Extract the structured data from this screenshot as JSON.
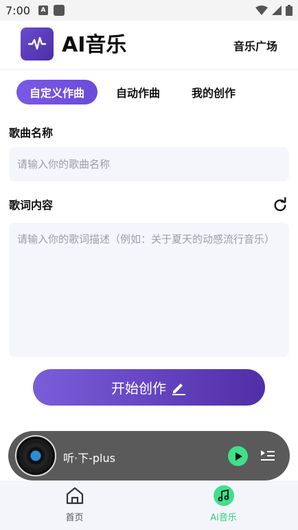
{
  "status_bar": {
    "time": "7:00",
    "badge": "A"
  },
  "header": {
    "title": "AI音乐",
    "plaza_link": "音乐广场"
  },
  "tabs": [
    {
      "label": "自定义作曲",
      "active": true
    },
    {
      "label": "自动作曲",
      "active": false
    },
    {
      "label": "我的创作",
      "active": false
    }
  ],
  "form": {
    "song_name_label": "歌曲名称",
    "song_name_placeholder": "请输入你的歌曲名称",
    "lyrics_label": "歌词内容",
    "lyrics_placeholder": "请输入你的歌词描述（例如：关于夏天的动感流行音乐）",
    "start_button": "开始创作"
  },
  "player": {
    "song_title": "听·下-plus"
  },
  "bottom_nav": [
    {
      "label": "首页",
      "icon": "home-icon",
      "active": false
    },
    {
      "label": "Ai音乐",
      "icon": "music-note-icon",
      "active": true
    }
  ],
  "colors": {
    "accent": "#6b4bd9",
    "play_green": "#3fe08c",
    "nav_active": "#2ecf7a",
    "input_bg": "#f5f6fb"
  }
}
